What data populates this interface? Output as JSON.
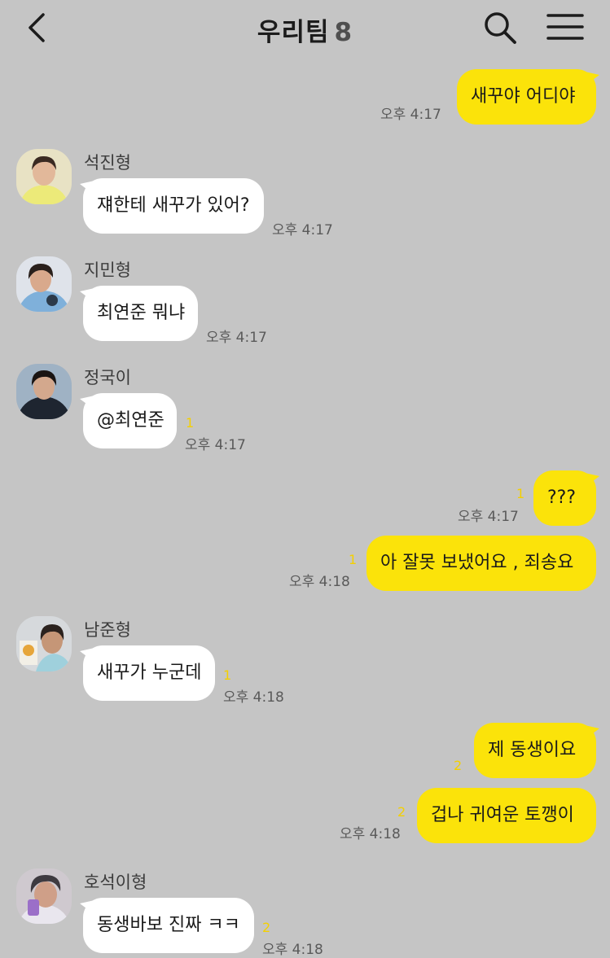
{
  "header": {
    "title": "우리팀",
    "member_count": "8",
    "back_icon": "chevron-left-icon",
    "search_icon": "search-icon",
    "menu_icon": "hamburger-menu-icon"
  },
  "colors": {
    "background": "#c5c5c5",
    "outgoing_bubble": "#fbe30a",
    "incoming_bubble": "#ffffff",
    "unread_count": "#f4d000"
  },
  "messages": [
    {
      "direction": "out",
      "text": "새꾸야 어디야",
      "time": "오후 4:17",
      "unread": ""
    },
    {
      "direction": "in",
      "sender": "석진형",
      "text": "쟤한테 새꾸가 있어?",
      "time": "오후 4:17",
      "unread": ""
    },
    {
      "direction": "in",
      "sender": "지민형",
      "text": "최연준 뭐냐",
      "time": "오후 4:17",
      "unread": ""
    },
    {
      "direction": "in",
      "sender": "정국이",
      "text": "@최연준",
      "time": "오후 4:17",
      "unread": "1"
    },
    {
      "direction": "out",
      "text": "???",
      "time": "오후 4:17",
      "unread": "1"
    },
    {
      "direction": "out",
      "text": "아 잘못 보냈어요 , 죄송요",
      "time": "오후 4:18",
      "unread": "1"
    },
    {
      "direction": "in",
      "sender": "남준형",
      "text": "새꾸가 누군데",
      "time": "오후 4:18",
      "unread": "1"
    },
    {
      "direction": "out",
      "text": "제 동생이요",
      "time": "",
      "unread": "2"
    },
    {
      "direction": "out",
      "text": "겁나 귀여운 토깽이",
      "time": "오후 4:18",
      "unread": "2"
    },
    {
      "direction": "in",
      "sender": "호석이형",
      "text": "동생바보 진짜 ㅋㅋ",
      "time": "오후 4:18",
      "unread": "2"
    }
  ]
}
